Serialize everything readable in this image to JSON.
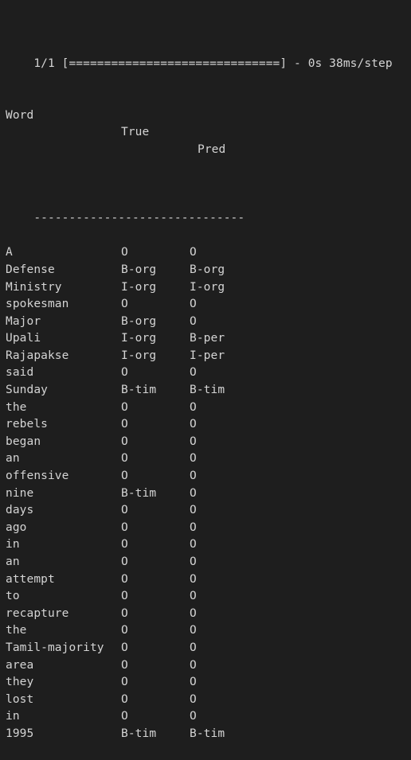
{
  "progress_line": "1/1 [==============================] - 0s 38ms/step",
  "header": {
    "word": "Word",
    "true": "True",
    "pred": "Pred"
  },
  "separator": "------------------------------",
  "rows": [
    {
      "word": "A",
      "true": "O",
      "pred": "O"
    },
    {
      "word": "Defense",
      "true": "B-org",
      "pred": "B-org"
    },
    {
      "word": "Ministry",
      "true": "I-org",
      "pred": "I-org"
    },
    {
      "word": "spokesman",
      "true": "O",
      "pred": "O"
    },
    {
      "word": "Major",
      "true": "B-org",
      "pred": "O"
    },
    {
      "word": "Upali",
      "true": "I-org",
      "pred": "B-per"
    },
    {
      "word": "Rajapakse",
      "true": "I-org",
      "pred": "I-per"
    },
    {
      "word": "said",
      "true": "O",
      "pred": "O"
    },
    {
      "word": "Sunday",
      "true": "B-tim",
      "pred": "B-tim"
    },
    {
      "word": "the",
      "true": "O",
      "pred": "O"
    },
    {
      "word": "rebels",
      "true": "O",
      "pred": "O"
    },
    {
      "word": "began",
      "true": "O",
      "pred": "O"
    },
    {
      "word": "an",
      "true": "O",
      "pred": "O"
    },
    {
      "word": "offensive",
      "true": "O",
      "pred": "O"
    },
    {
      "word": "nine",
      "true": "B-tim",
      "pred": "O"
    },
    {
      "word": "days",
      "true": "O",
      "pred": "O"
    },
    {
      "word": "ago",
      "true": "O",
      "pred": "O"
    },
    {
      "word": "in",
      "true": "O",
      "pred": "O"
    },
    {
      "word": "an",
      "true": "O",
      "pred": "O"
    },
    {
      "word": "attempt",
      "true": "O",
      "pred": "O"
    },
    {
      "word": "to",
      "true": "O",
      "pred": "O"
    },
    {
      "word": "recapture",
      "true": "O",
      "pred": "O"
    },
    {
      "word": "the",
      "true": "O",
      "pred": "O"
    },
    {
      "word": "Tamil-majority",
      "true": "O",
      "pred": "O"
    },
    {
      "word": "area",
      "true": "O",
      "pred": "O"
    },
    {
      "word": "they",
      "true": "O",
      "pred": "O"
    },
    {
      "word": "lost",
      "true": "O",
      "pred": "O"
    },
    {
      "word": "in",
      "true": "O",
      "pred": "O"
    },
    {
      "word": "1995",
      "true": "B-tim",
      "pred": "B-tim"
    }
  ]
}
